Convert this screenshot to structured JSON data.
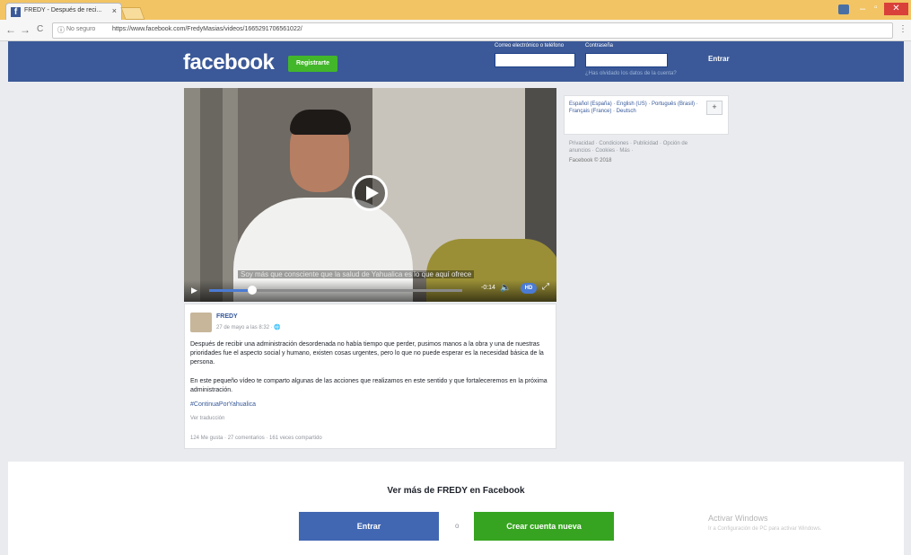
{
  "browser": {
    "tab_title": "FREDY - Después de reci...",
    "tab_close": "×",
    "nav_back": "←",
    "nav_forward": "→",
    "nav_reload": "C",
    "secure_label": "No seguro",
    "url": "https://www.facebook.com/FredyMasias/videos/1665291706561022/",
    "menu": "⋮"
  },
  "header": {
    "logo": "facebook",
    "signup_button": "Registrarte",
    "email_label": "Correo electrónico o teléfono",
    "password_label": "Contraseña",
    "forgot_link": "¿Has olvidado los datos de la cuenta?",
    "login_button": "Entrar"
  },
  "video": {
    "caption": "Soy más que consciente que la salud de Yahualica es lo que aquí ofrece",
    "time": "-0:14",
    "hd_label": "HD"
  },
  "post": {
    "author": "FREDY",
    "date": "27 de mayo a las 8:32 · 🌐",
    "paragraph1": "Después de recibir una administración desordenada no había tiempo que perder, pusimos manos a la obra y una de nuestras prioridades fue el aspecto social y humano, existen cosas urgentes, pero lo que no puede esperar es la necesidad básica de la persona.",
    "paragraph2": "En este pequeño vídeo te comparto algunas de las acciones que realizamos en este sentido y que fortaleceremos en la próxima administración.",
    "hashtag": "#ContinuaPorYahualica",
    "see_translation": "Ver traducción",
    "stats": "124 Me gusta · 27 comentarios · 161 veces compartido"
  },
  "sidebar": {
    "languages": "Español (España) · English (US) · Português (Brasil) · Français (France) · Deutsch",
    "add_language": "+",
    "footer_links": "Privacidad · Condiciones · Publicidad · Opción de anuncios · Cookies · Más ·",
    "copyright": "Facebook © 2018"
  },
  "bottom": {
    "see_more": "Ver más de FREDY en Facebook",
    "enter_button": "Entrar",
    "or": "o",
    "create_button": "Crear cuenta nueva"
  },
  "windows_watermark": {
    "line1": "Activar Windows",
    "line2": "Ir a Configuración de PC para activar Windows."
  },
  "colors": {
    "facebook_blue": "#3b5998",
    "button_blue": "#4267b2",
    "button_green": "#36a420",
    "link": "#365899"
  },
  "video_progress": 0.17
}
